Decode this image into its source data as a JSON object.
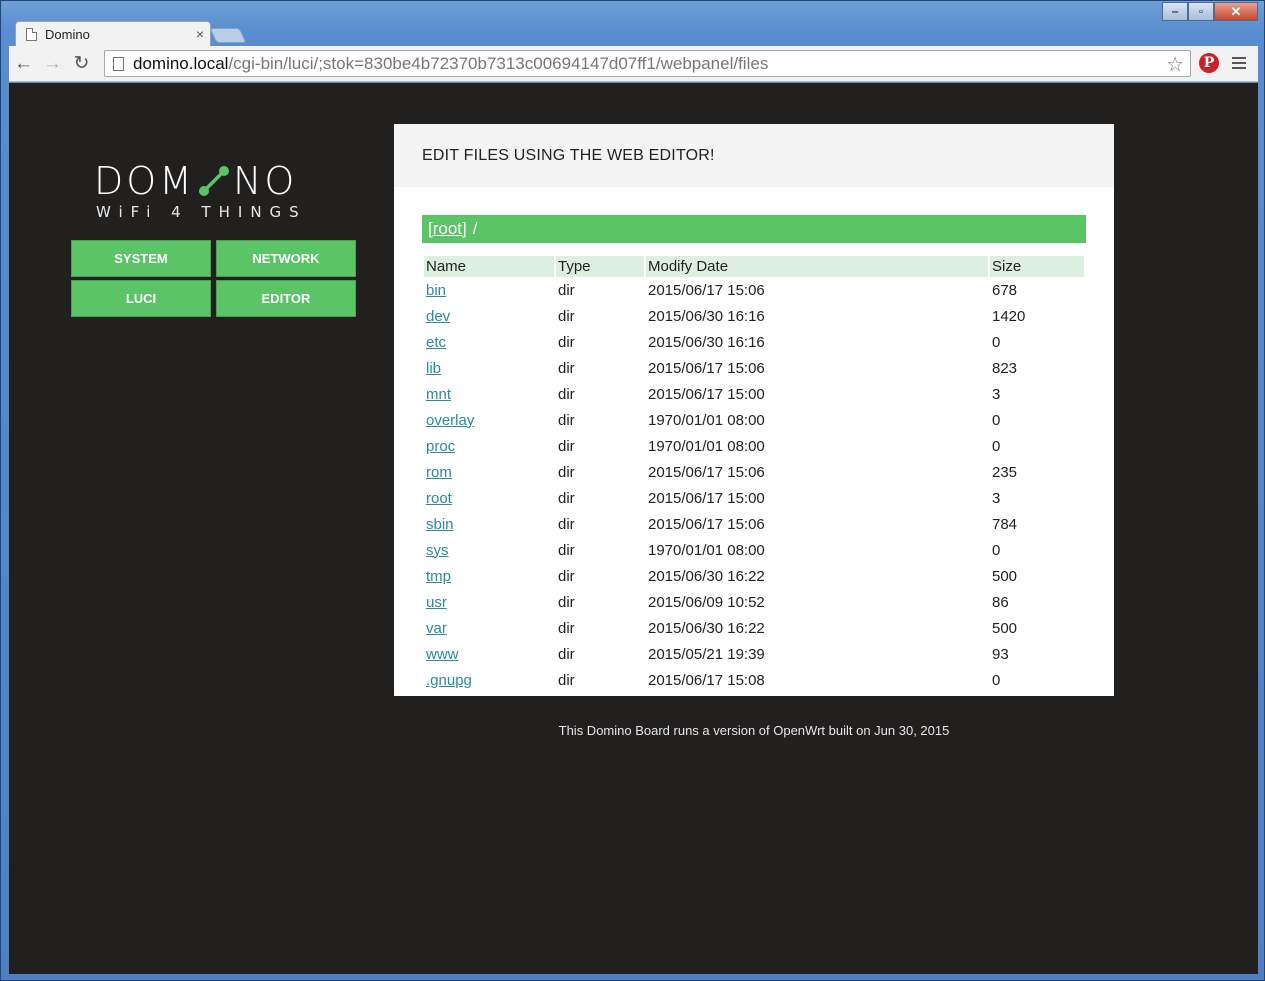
{
  "browser": {
    "tab_title": "Domino",
    "tab_close": "×",
    "url_host": "domino.local",
    "url_path": "/cgi-bin/luci/;stok=830be4b72370b7313c00694147d07ff1/webpanel/files",
    "back": "←",
    "forward": "→",
    "reload": "↻",
    "star": "☆",
    "window_controls": {
      "minimize": "‒",
      "maximize": "▫",
      "close": "✕"
    }
  },
  "logo": {
    "word_left": "DOM",
    "word_right": "NO",
    "tagline": "WiFi 4 THINGS",
    "accent_color": "#5bc466"
  },
  "nav": {
    "system": "SYSTEM",
    "network": "NETWORK",
    "luci": "LUCI",
    "editor": "EDITOR"
  },
  "panel": {
    "heading": "EDIT FILES USING THE WEB EDITOR!",
    "path_root": "[root]",
    "path_sep": "/"
  },
  "files": {
    "headers": {
      "name": "Name",
      "type": "Type",
      "date": "Modify Date",
      "size": "Size"
    },
    "rows": [
      {
        "name": "bin",
        "type": "dir",
        "date": "2015/06/17 15:06",
        "size": "678"
      },
      {
        "name": "dev",
        "type": "dir",
        "date": "2015/06/30 16:16",
        "size": "1420"
      },
      {
        "name": "etc",
        "type": "dir",
        "date": "2015/06/30 16:16",
        "size": "0"
      },
      {
        "name": "lib",
        "type": "dir",
        "date": "2015/06/17 15:06",
        "size": "823"
      },
      {
        "name": "mnt",
        "type": "dir",
        "date": "2015/06/17 15:00",
        "size": "3"
      },
      {
        "name": "overlay",
        "type": "dir",
        "date": "1970/01/01 08:00",
        "size": "0"
      },
      {
        "name": "proc",
        "type": "dir",
        "date": "1970/01/01 08:00",
        "size": "0"
      },
      {
        "name": "rom",
        "type": "dir",
        "date": "2015/06/17 15:06",
        "size": "235"
      },
      {
        "name": "root",
        "type": "dir",
        "date": "2015/06/17 15:00",
        "size": "3"
      },
      {
        "name": "sbin",
        "type": "dir",
        "date": "2015/06/17 15:06",
        "size": "784"
      },
      {
        "name": "sys",
        "type": "dir",
        "date": "1970/01/01 08:00",
        "size": "0"
      },
      {
        "name": "tmp",
        "type": "dir",
        "date": "2015/06/30 16:22",
        "size": "500"
      },
      {
        "name": "usr",
        "type": "dir",
        "date": "2015/06/09 10:52",
        "size": "86"
      },
      {
        "name": "var",
        "type": "dir",
        "date": "2015/06/30 16:22",
        "size": "500"
      },
      {
        "name": "www",
        "type": "dir",
        "date": "2015/05/21 19:39",
        "size": "93"
      },
      {
        "name": ".gnupg",
        "type": "dir",
        "date": "2015/06/17 15:08",
        "size": "0"
      }
    ]
  },
  "footer": "This Domino Board runs a version of OpenWrt built on Jun 30, 2015",
  "colors": {
    "accent_green": "#5bc466",
    "page_bg": "#221f1f",
    "link": "#2b8a9c"
  }
}
